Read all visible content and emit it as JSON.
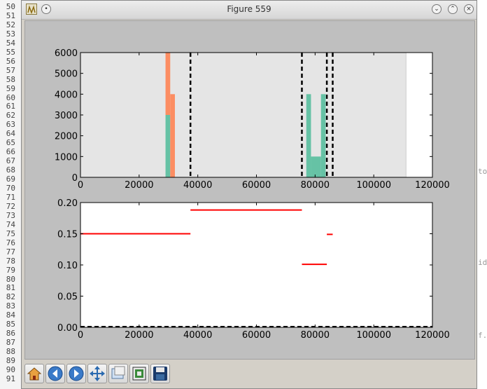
{
  "window": {
    "title": "Figure 559"
  },
  "editor": {
    "line_numbers": [
      "50",
      "51",
      "52",
      "53",
      "54",
      "55",
      "56",
      "57",
      "58",
      "59",
      "60",
      "61",
      "62",
      "63",
      "64",
      "65",
      "66",
      "67",
      "68",
      "69",
      "70",
      "71",
      "72",
      "73",
      "74",
      "75",
      "76",
      "77",
      "78",
      "79",
      "80",
      "81",
      "82",
      "83",
      "84",
      "85",
      "86",
      "87",
      "88",
      "89",
      "90",
      "91"
    ],
    "right_fragments": [
      "to",
      "id",
      "f."
    ]
  },
  "toolbar": {
    "tools": [
      {
        "name": "home-icon",
        "label": "Home"
      },
      {
        "name": "back-icon",
        "label": "Back"
      },
      {
        "name": "forward-icon",
        "label": "Forward"
      },
      {
        "name": "pan-icon",
        "label": "Pan"
      },
      {
        "name": "zoom-icon",
        "label": "Zoom"
      },
      {
        "name": "subplots-icon",
        "label": "Configure subplots"
      },
      {
        "name": "save-icon",
        "label": "Save"
      }
    ]
  },
  "chart_data": [
    {
      "type": "bar",
      "xlim": [
        0,
        120000
      ],
      "ylim": [
        0,
        6000
      ],
      "xticks": [
        "0",
        "20000",
        "40000",
        "60000",
        "80000",
        "100000",
        "120000"
      ],
      "yticks": [
        "0",
        "1000",
        "2000",
        "3000",
        "4000",
        "5000",
        "6000"
      ],
      "shaded_range": [
        0,
        111000
      ],
      "colors": {
        "shade": "#e5e5e5",
        "orange": "#fc8d62",
        "green": "#66c2a5",
        "vline": "#000000"
      },
      "series": [
        {
          "color_key": "green",
          "bars": [
            {
              "x0": 29000,
              "x1": 30600,
              "value": 3000
            },
            {
              "x0": 77000,
              "x1": 78600,
              "value": 4000
            },
            {
              "x0": 78600,
              "x1": 82000,
              "value": 1000
            },
            {
              "x0": 82000,
              "x1": 83600,
              "value": 4000
            }
          ]
        },
        {
          "color_key": "orange",
          "bars": [
            {
              "x0": 29000,
              "x1": 30600,
              "value": 6000,
              "base": 3000
            },
            {
              "x0": 30600,
              "x1": 32200,
              "value": 4000,
              "base": 0
            }
          ]
        }
      ],
      "vlines": [
        37500,
        75500,
        84000,
        86000
      ]
    },
    {
      "type": "line",
      "xlim": [
        0,
        120000
      ],
      "ylim": [
        0,
        0.2
      ],
      "xticks": [
        "0",
        "20000",
        "40000",
        "60000",
        "80000",
        "100000",
        "120000"
      ],
      "yticks": [
        "0.00",
        "0.05",
        "0.10",
        "0.15",
        "0.20"
      ],
      "colors": {
        "segment": "#ff0000",
        "baseline": "#000000"
      },
      "segments": [
        {
          "x0": 0,
          "x1": 37500,
          "y": 0.15
        },
        {
          "x0": 37500,
          "x1": 75500,
          "y": 0.188
        },
        {
          "x0": 75500,
          "x1": 84000,
          "y": 0.101
        },
        {
          "x0": 84000,
          "x1": 86000,
          "y": 0.149
        }
      ],
      "baseline_y": 0
    }
  ]
}
